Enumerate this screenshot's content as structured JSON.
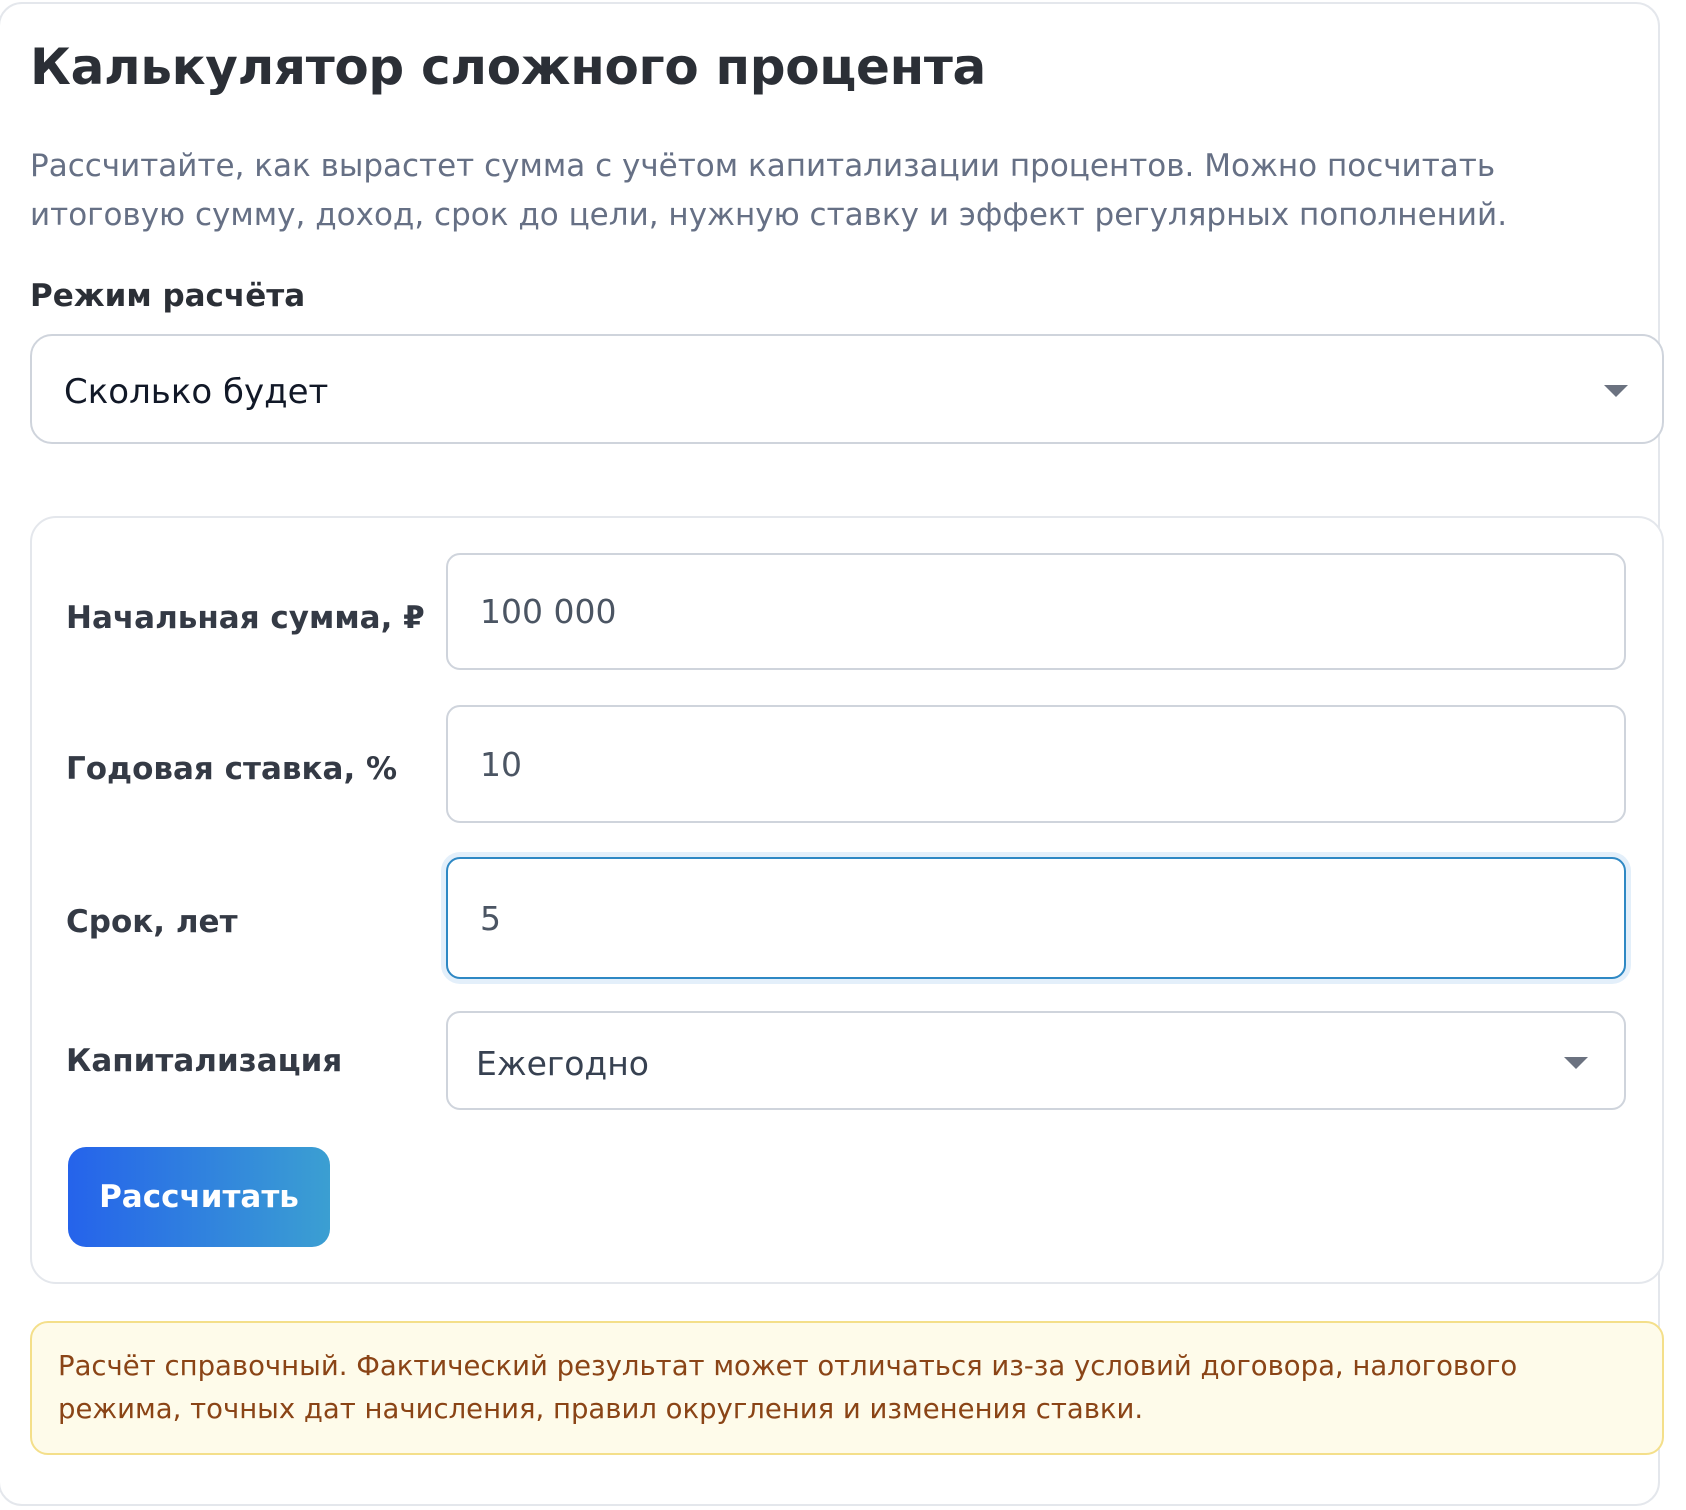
{
  "header": {
    "title": "Калькулятор сложного процента",
    "description": "Рассчитайте, как вырастет сумма с учётом капитализации процентов. Можно посчитать итоговую сумму, доход, срок до цели, нужную ставку и эффект регулярных пополнений."
  },
  "mode": {
    "label": "Режим расчёта",
    "selected": "Сколько будет"
  },
  "form": {
    "fields": [
      {
        "label": "Начальная сумма, ₽",
        "value": "100 000"
      },
      {
        "label": "Годовая ставка, %",
        "value": "10"
      },
      {
        "label": "Срок, лет",
        "value": "5"
      }
    ],
    "capitalization": {
      "label": "Капитализация",
      "selected": "Ежегодно"
    },
    "submit_label": "Рассчитать"
  },
  "notice": {
    "text": "Расчёт справочный. Фактический результат может отличаться из-за условий договора, налогового режима, точных дат начисления, правил округления и изменения ставки."
  },
  "colors": {
    "accent_start": "#2563eb",
    "accent_end": "#3b9fd2",
    "focus_border": "#2e88c4",
    "notice_bg": "#fefbea",
    "notice_text": "#8a4416"
  },
  "icons": {
    "dropdown": "chevron-down-icon"
  }
}
